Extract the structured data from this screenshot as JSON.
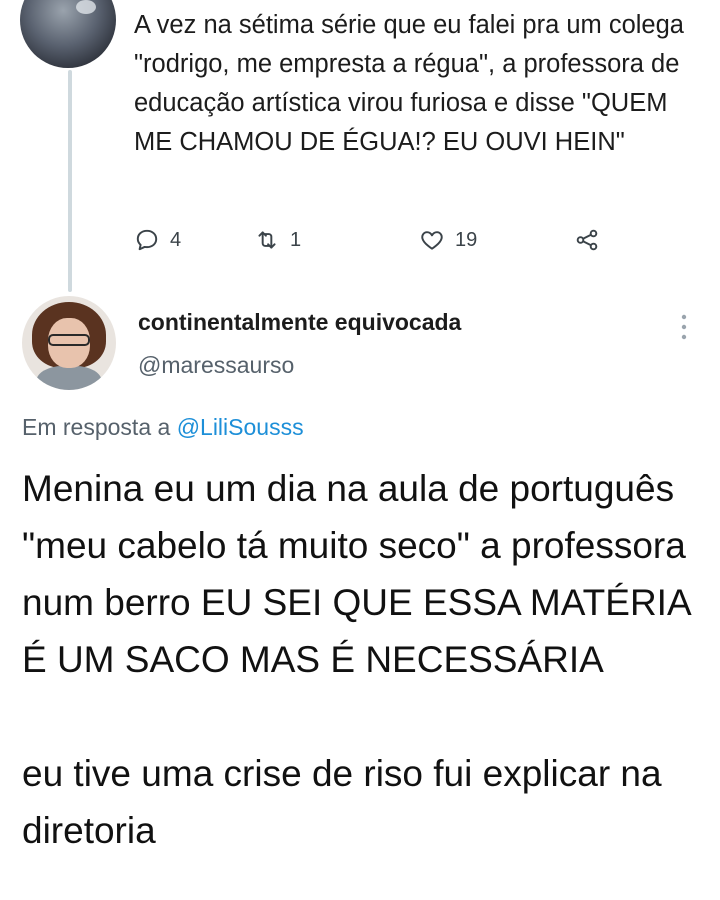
{
  "parent_tweet": {
    "avatar": "profile-photo",
    "text": "A vez na sétima série que eu falei pra um colega \"rodrigo, me empresta a régua\", a professora de educação artística virou furiosa e disse \"QUEM ME CHAMOU DE ÉGUA!? EU OUVI HEIN\"",
    "actions": {
      "replies": "4",
      "retweets": "1",
      "likes": "19",
      "reply_icon": "comment-icon",
      "retweet_icon": "retweet-icon",
      "like_icon": "heart-icon",
      "share_icon": "share-icon"
    }
  },
  "reply_tweet": {
    "display_name": "continentalmente equivocada",
    "handle": "@maressaurso",
    "more_icon": "more-vertical-icon",
    "reply_prefix": "Em resposta a ",
    "reply_mention": "@LiliSousss",
    "text": "Menina eu um dia na aula de português \"meu cabelo tá muito seco\" a professora num berro EU SEI QUE ESSA MATÉRIA É UM SACO MAS É NECESSÁRIA\n\neu tive uma crise de riso fui explicar na diretoria"
  },
  "colors": {
    "mention": "#1d8fd8",
    "secondary_text": "#56616b",
    "thread_line": "#cfd9de"
  }
}
